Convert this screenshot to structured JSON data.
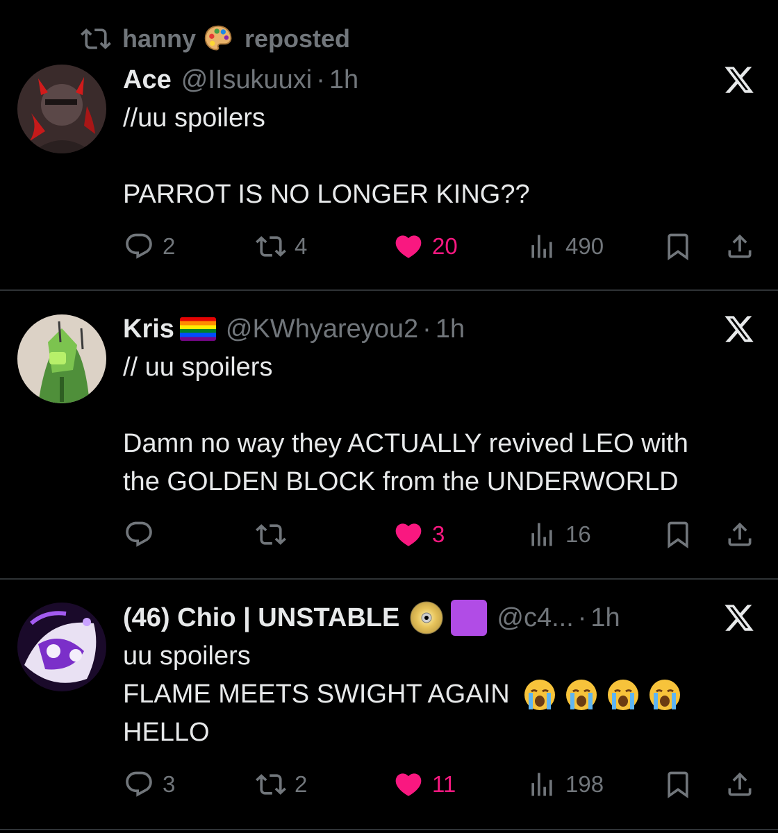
{
  "repost": {
    "user": "hanny",
    "label": "reposted"
  },
  "tweets": [
    {
      "name": "Ace",
      "handle": "@IIsukuuxi",
      "sep": "·",
      "time": "1h",
      "lines": [
        "//uu spoilers",
        "",
        "PARROT IS NO LONGER KING??"
      ],
      "replies": "2",
      "reposts": "4",
      "likes": "20",
      "views": "490"
    },
    {
      "name": "Kris",
      "handle": "@KWhyareyou2",
      "sep": "·",
      "time": "1h",
      "lines": [
        "// uu spoilers",
        "",
        "Damn no way they ACTUALLY revived LEO with",
        "the GOLDEN BLOCK from the UNDERWORLD"
      ],
      "replies": "",
      "reposts": "",
      "likes": "3",
      "views": "16"
    },
    {
      "name": "(46) Chio | UNSTABLE",
      "handle": "@c4...",
      "sep": "·",
      "time": "1h",
      "lines": [
        "uu spoilers",
        "FLAME MEETS SWIGHT AGAIN",
        "HELLO"
      ],
      "replies": "3",
      "reposts": "2",
      "likes": "11",
      "views": "198"
    }
  ],
  "icons": {
    "repost": "repost-icon",
    "reply": "reply-icon",
    "like": "heart-icon",
    "views": "views-icon",
    "bookmark": "bookmark-icon",
    "share": "share-icon",
    "x": "x-logo-icon"
  },
  "colors": {
    "background": "#000000",
    "text": "#e7e9ea",
    "muted": "#71767b",
    "like": "#f91880",
    "divider": "#2f3336"
  }
}
